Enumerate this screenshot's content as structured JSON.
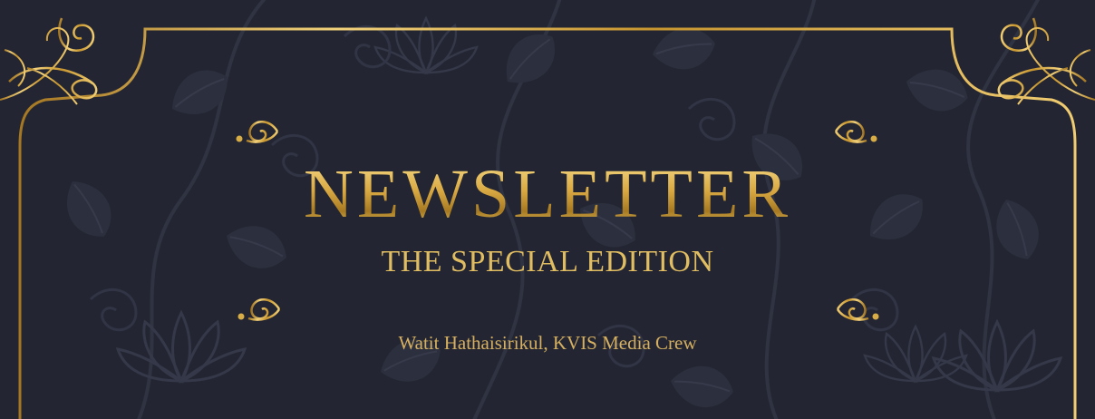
{
  "newsletter": {
    "title": "NEWSLETTER",
    "subtitle": "THE SPECIAL EDITION",
    "author_line": "Watit Hathaisirikul, KVIS Media Crew"
  },
  "colors": {
    "background": "#232632",
    "gold": "#d9ad45",
    "gold_light": "#f3d27c",
    "pattern": "#2c303e"
  },
  "icons": {
    "corner": "flourish-corner-icon",
    "divider_end": "scroll-end-icon",
    "pattern": "floral-pattern"
  }
}
